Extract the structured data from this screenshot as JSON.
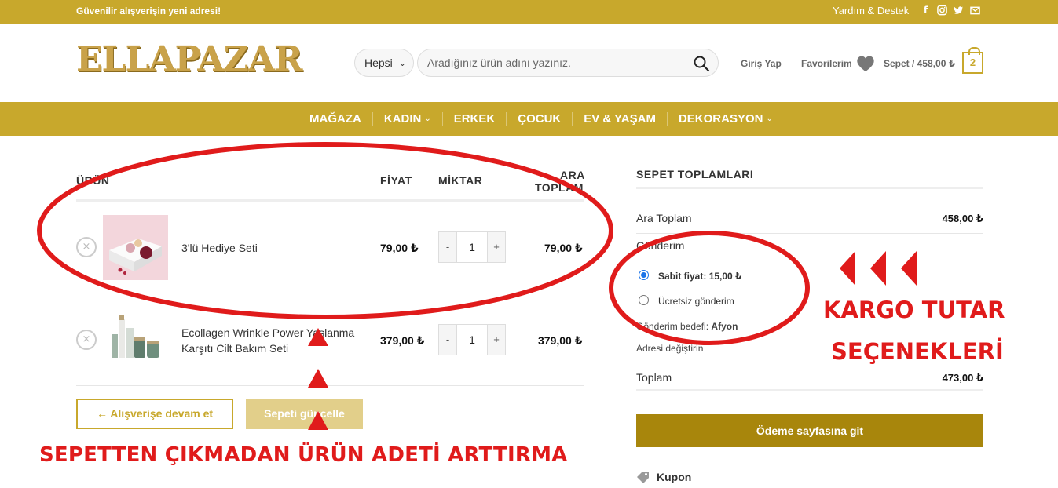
{
  "topbar": {
    "tagline": "Güvenilir alışverişin yeni adresi!",
    "help": "Yardım & Destek",
    "social": [
      "facebook-icon",
      "instagram-icon",
      "twitter-icon",
      "mail-icon"
    ]
  },
  "header": {
    "logo": "ELLAPAZAR",
    "category_select": "Hepsi",
    "search_placeholder": "Aradığınız ürün adını yazınız.",
    "login": "Giriş Yap",
    "favorites": "Favorilerim",
    "cart": "Sepet / 458,00 ₺",
    "cart_count": "2"
  },
  "nav": {
    "items": [
      {
        "label": "MAĞAZA",
        "dropdown": false
      },
      {
        "label": "KADIN",
        "dropdown": true
      },
      {
        "label": "ERKEK",
        "dropdown": false
      },
      {
        "label": "ÇOCUK",
        "dropdown": false
      },
      {
        "label": "EV & YAŞAM",
        "dropdown": false
      },
      {
        "label": "DEKORASYON",
        "dropdown": true
      }
    ]
  },
  "cart": {
    "columns": {
      "product": "ÜRÜN",
      "price": "FİYAT",
      "quantity": "MİKTAR",
      "subtotal_1": "ARA",
      "subtotal_2": "TOPLAM"
    },
    "items": [
      {
        "name_1": "3'lü Hediye Seti",
        "name_2": "",
        "price": "79,00 ₺",
        "qty": "1",
        "subtotal": "79,00 ₺"
      },
      {
        "name_1": "Ecollagen Wrinkle Power Yaşlanma",
        "name_2": "Karşıtı Cilt Bakım Seti",
        "price": "379,00 ₺",
        "qty": "1",
        "subtotal": "379,00 ₺"
      }
    ],
    "minus": "-",
    "plus": "+",
    "remove": "×",
    "continue_button": "← Alışverişe devam et",
    "update_button": "Sepeti güncelle"
  },
  "totals": {
    "heading": "SEPET TOPLAMLARI",
    "subtotal_label": "Ara Toplam",
    "subtotal_value": "458,00 ₺",
    "shipping_label": "Gönderim",
    "option_fixed_label": "Sabit fiyat:",
    "option_fixed_value": "15,00 ₺",
    "option_free": "Ücretsiz gönderim",
    "ship_to_label": "Gönderim bedefi:",
    "ship_to_value": "Afyon",
    "change_address": "Adresi değiştirin",
    "total_label": "Toplam",
    "total_value": "473,00 ₺",
    "checkout_button": "Ödeme sayfasına git",
    "coupon": "Kupon"
  },
  "annotations": {
    "shipping_note_1": "KARGO TUTAR",
    "shipping_note_2": "SEÇENEKLERİ",
    "quantity_note": "SEPETTEN ÇIKMADAN ÜRÜN ADETİ ARTTIRMA",
    "color": "#e01b1b"
  },
  "colors": {
    "brand": "#c8a82c",
    "checkout": "#a8860c",
    "update_disabled": "#e2cf8a"
  }
}
